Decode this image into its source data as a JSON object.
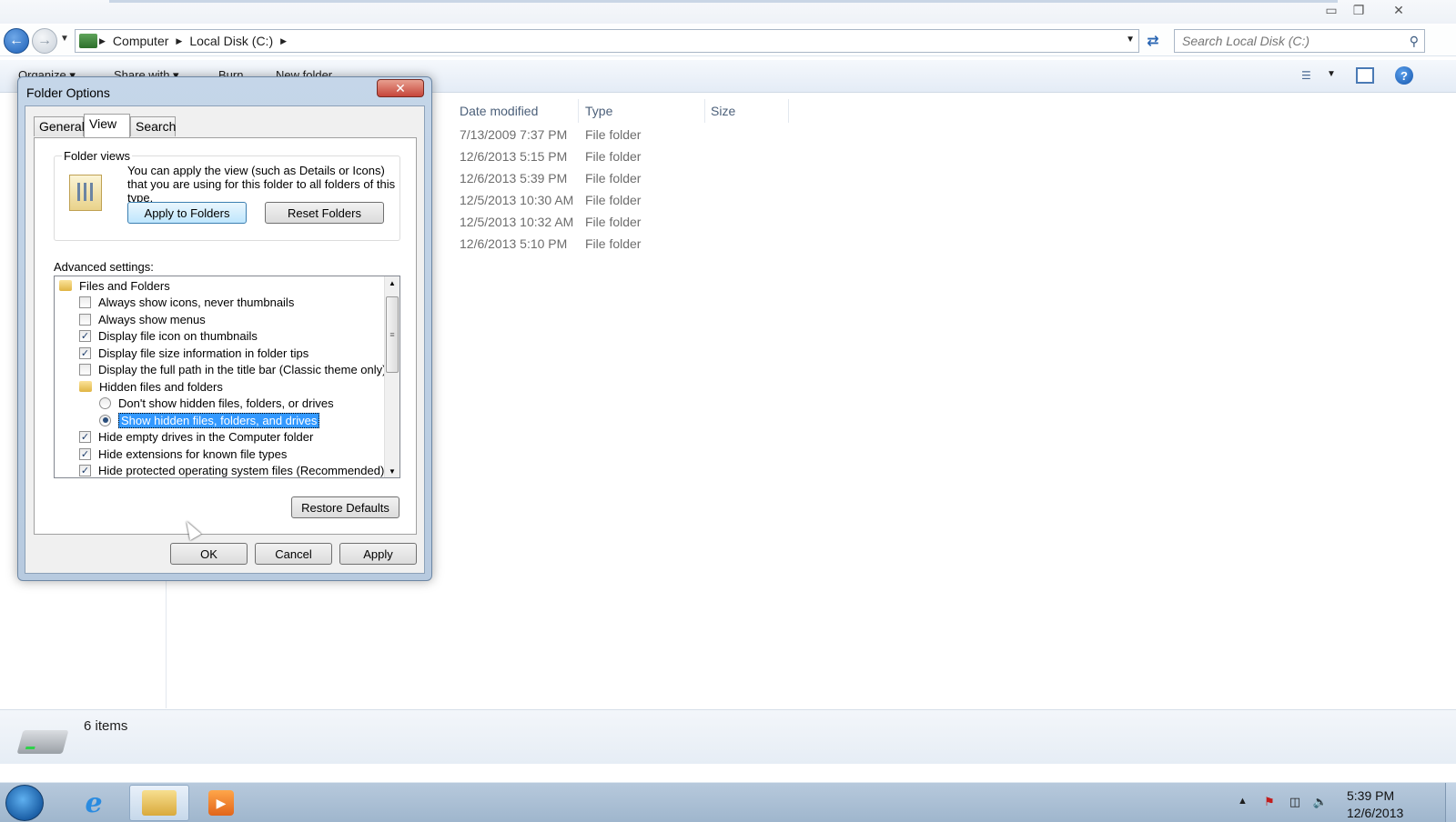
{
  "window": {
    "minimize": "▭",
    "maximize": "❐",
    "close": "✕"
  },
  "address": {
    "crumbs": [
      "Computer",
      "Local Disk (C:)"
    ],
    "search_placeholder": "Search Local Disk (C:)"
  },
  "toolbar": {
    "organize": "Organize ▾",
    "share": "Share with ▾",
    "burn": "Burn",
    "new_folder": "New folder",
    "help": "?"
  },
  "filelist": {
    "columns": [
      "Date modified",
      "Type",
      "Size"
    ],
    "rows": [
      {
        "date": "7/13/2009 7:37 PM",
        "type": "File folder"
      },
      {
        "date": "12/6/2013 5:15 PM",
        "type": "File folder"
      },
      {
        "date": "12/6/2013 5:39 PM",
        "type": "File folder"
      },
      {
        "date": "12/5/2013 10:30 AM",
        "type": "File folder"
      },
      {
        "date": "12/5/2013 10:32 AM",
        "type": "File folder"
      },
      {
        "date": "12/6/2013 5:10 PM",
        "type": "File folder"
      }
    ]
  },
  "status": {
    "item_count": "6 items"
  },
  "taskbar": {
    "time": "5:39 PM",
    "date": "12/6/2013",
    "ie_glyph": "e",
    "media_glyph": "▶"
  },
  "dialog": {
    "title": "Folder Options",
    "close": "✕",
    "tabs": [
      "General",
      "View",
      "Search"
    ],
    "active_tab": "View",
    "folder_views": {
      "legend": "Folder views",
      "text": "You can apply the view (such as Details or Icons) that you are using for this folder to all folders of this type.",
      "apply_button": "Apply to Folders",
      "reset_button": "Reset Folders"
    },
    "advanced_label": "Advanced settings:",
    "advanced_items": [
      {
        "kind": "folder",
        "label": "Files and Folders"
      },
      {
        "kind": "checkbox",
        "checked": false,
        "label": "Always show icons, never thumbnails"
      },
      {
        "kind": "checkbox",
        "checked": false,
        "label": "Always show menus"
      },
      {
        "kind": "checkbox",
        "checked": true,
        "label": "Display file icon on thumbnails"
      },
      {
        "kind": "checkbox",
        "checked": true,
        "label": "Display file size information in folder tips"
      },
      {
        "kind": "checkbox",
        "checked": false,
        "label": "Display the full path in the title bar (Classic theme only)"
      },
      {
        "kind": "folder",
        "label": "Hidden files and folders"
      },
      {
        "kind": "radio",
        "checked": false,
        "label": "Don't show hidden files, folders, or drives"
      },
      {
        "kind": "radio",
        "checked": true,
        "selected": true,
        "label": "Show hidden files, folders, and drives"
      },
      {
        "kind": "checkbox",
        "checked": true,
        "label": "Hide empty drives in the Computer folder"
      },
      {
        "kind": "checkbox",
        "checked": true,
        "label": "Hide extensions for known file types"
      },
      {
        "kind": "checkbox",
        "checked": true,
        "label": "Hide protected operating system files (Recommended)"
      }
    ],
    "restore_defaults": "Restore Defaults",
    "ok": "OK",
    "cancel": "Cancel",
    "apply": "Apply"
  }
}
